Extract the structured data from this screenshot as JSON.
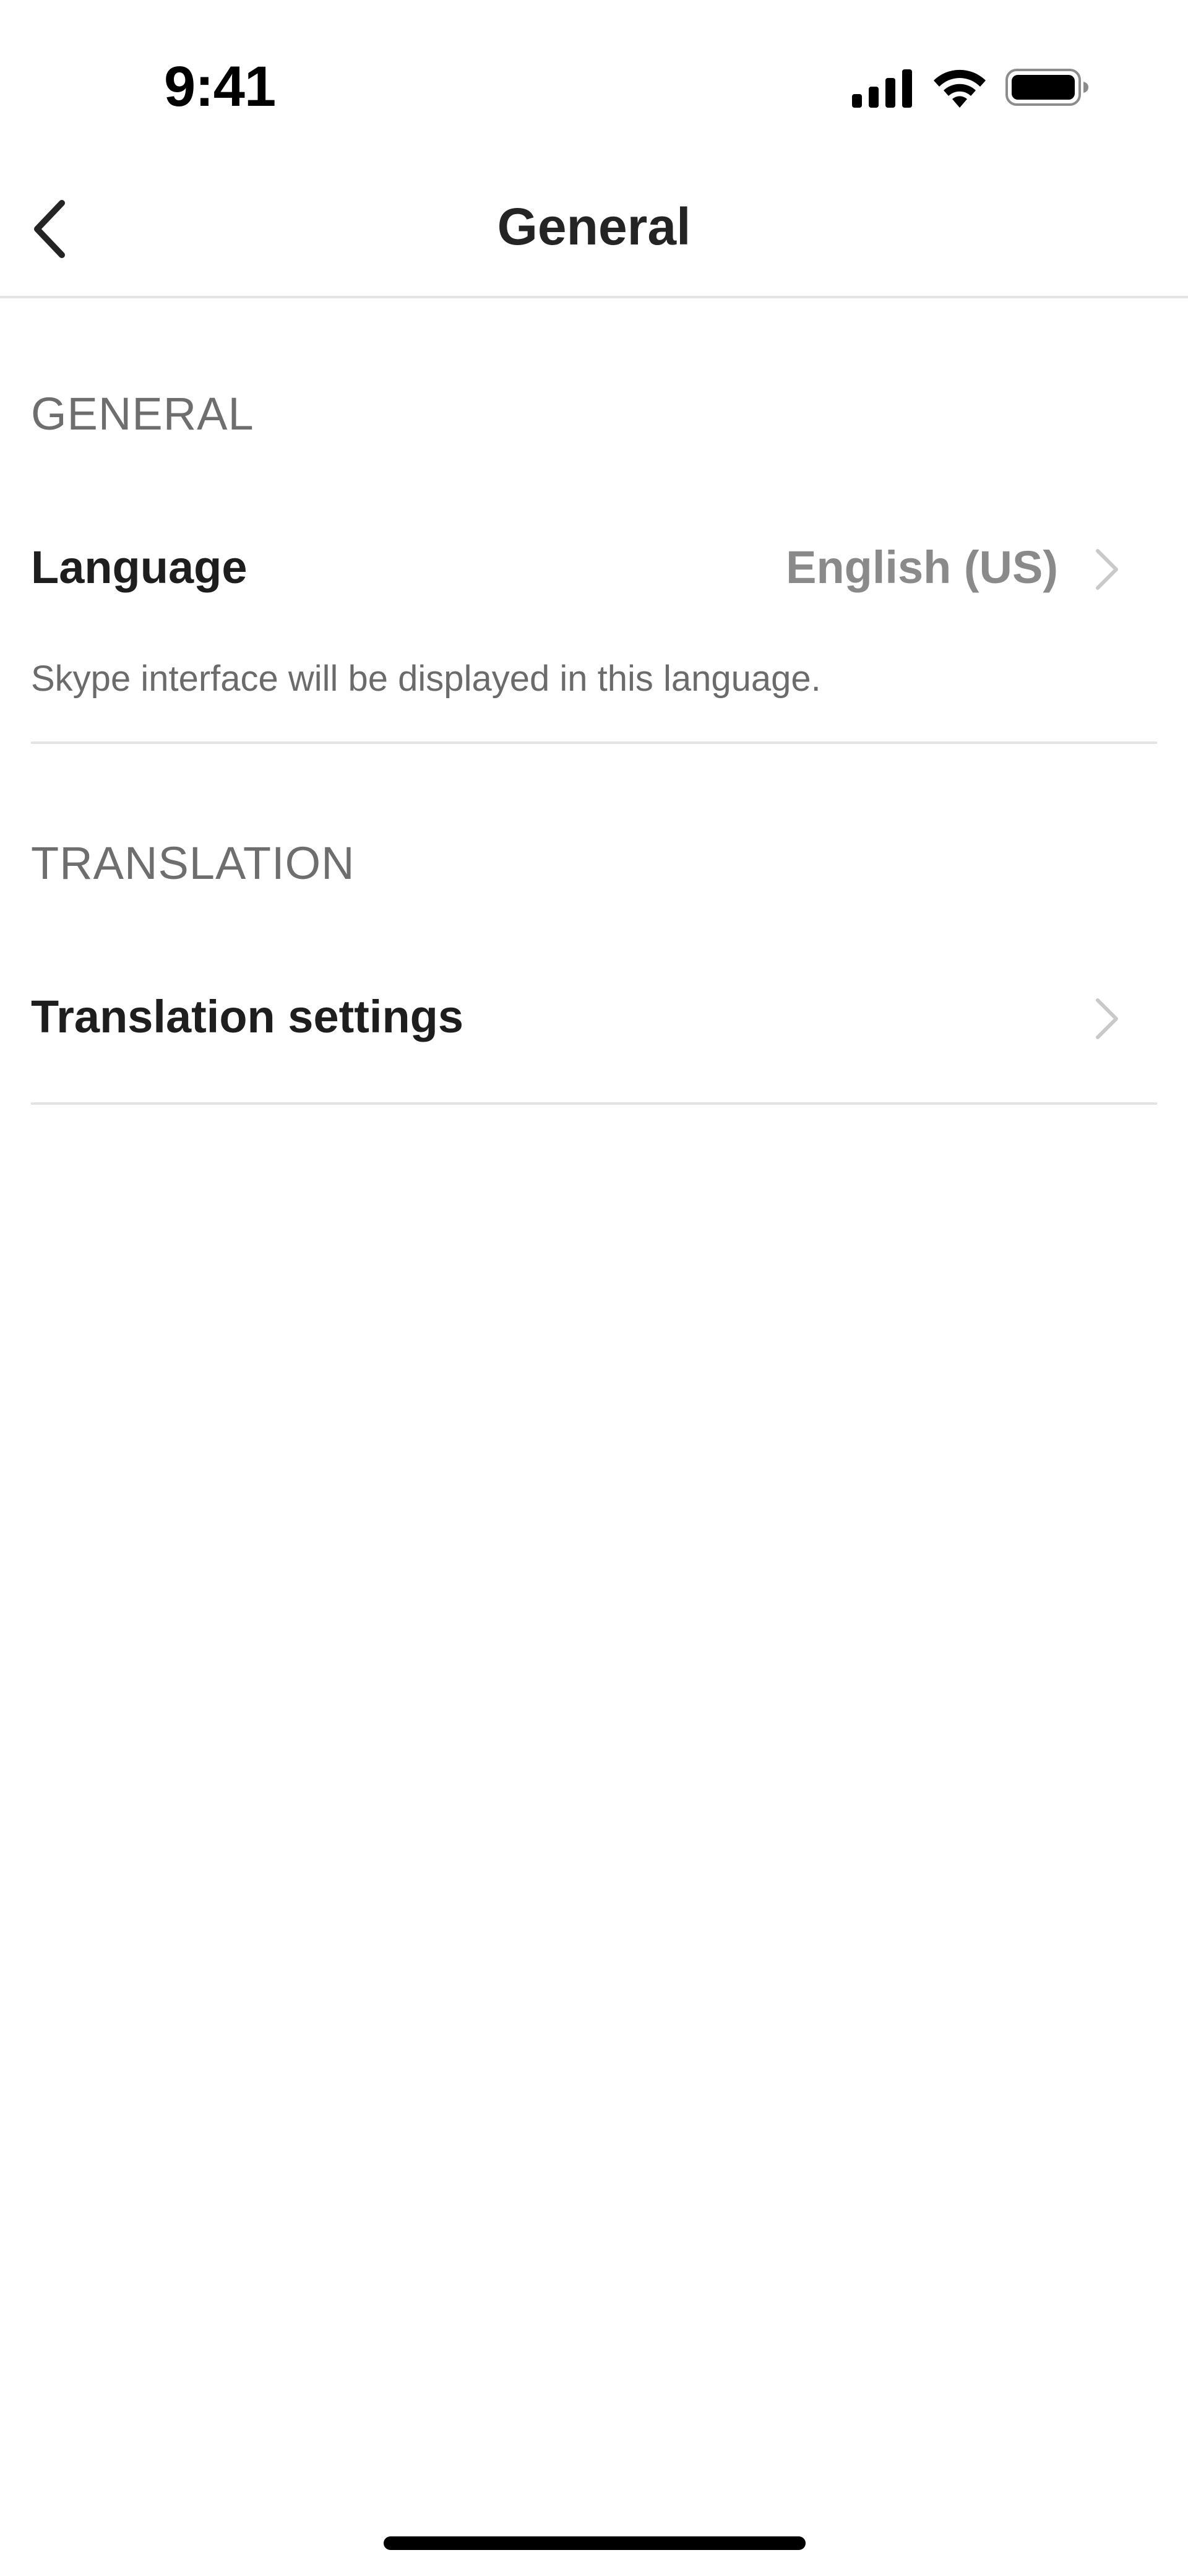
{
  "status_bar": {
    "time": "9:41",
    "signal_icon": "cellular-signal-icon",
    "wifi_icon": "wifi-icon",
    "battery_icon": "battery-icon"
  },
  "nav": {
    "title": "General",
    "back_icon": "chevron-left-icon"
  },
  "sections": {
    "general": {
      "header": "GENERAL",
      "language_row": {
        "label": "Language",
        "value": "English (US)",
        "description": "Skype interface will be displayed in this language."
      }
    },
    "translation": {
      "header": "TRANSLATION",
      "settings_row": {
        "label": "Translation settings"
      }
    }
  }
}
